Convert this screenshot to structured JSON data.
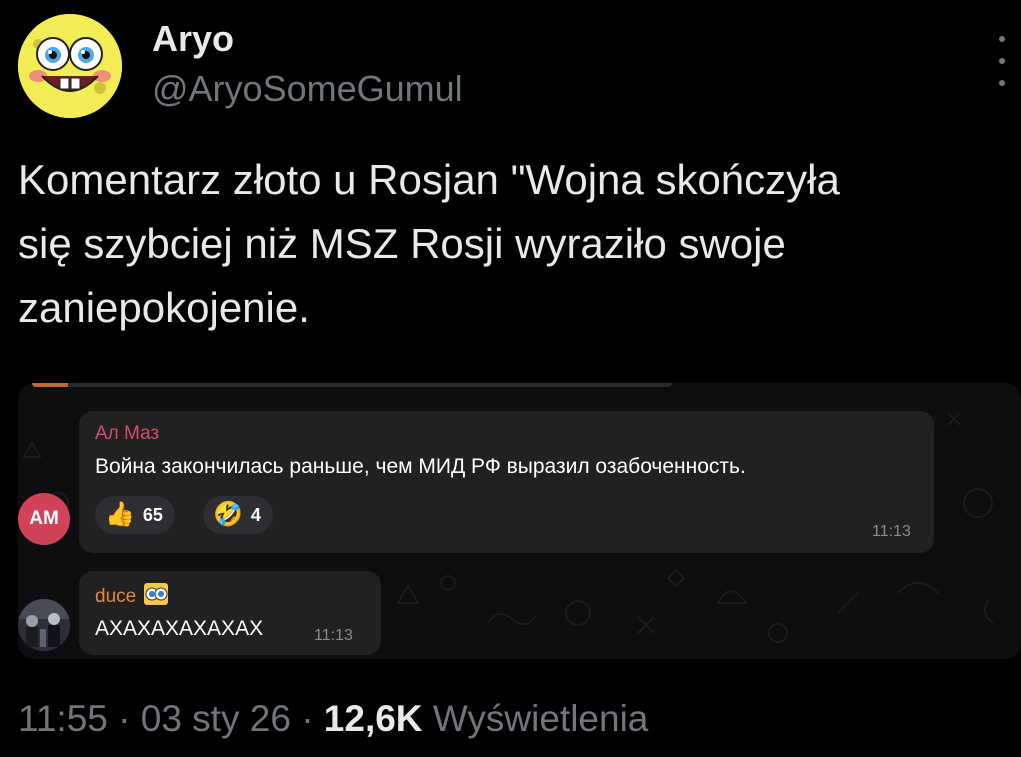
{
  "author": {
    "name": "Aryo",
    "handle": "@AryoSomeGumul",
    "avatar_icon": "spongebob-face-icon"
  },
  "tweet": {
    "lines": [
      "Komentarz złoto u Rosjan \"Wojna skończyła",
      "się szybciej niż MSZ Rosji wyraziło swoje",
      "zaniepokojenie."
    ]
  },
  "telegram": {
    "messages": [
      {
        "sender": "Ал Маз",
        "sender_color": "#d84a6a",
        "avatar_initials": "AM",
        "text": "Война закончилась раньше, чем МИД РФ выразил озабоченность.",
        "time": "11:13",
        "reactions": [
          {
            "icon": "thumbs-up-icon",
            "emoji": "👍",
            "count": "65"
          },
          {
            "icon": "rolling-laughing-icon",
            "emoji": "🤣",
            "count": "4"
          }
        ]
      },
      {
        "sender": "duce",
        "sender_color": "#e3883a",
        "status_icon": "eyes-icon",
        "text": "АХАХАХАХАХАХ",
        "time": "11:13"
      }
    ]
  },
  "meta": {
    "time": "11:55",
    "separator": "·",
    "date": "03 sty 26",
    "views_count": "12,6K",
    "views_label": "Wyświetlenia"
  }
}
